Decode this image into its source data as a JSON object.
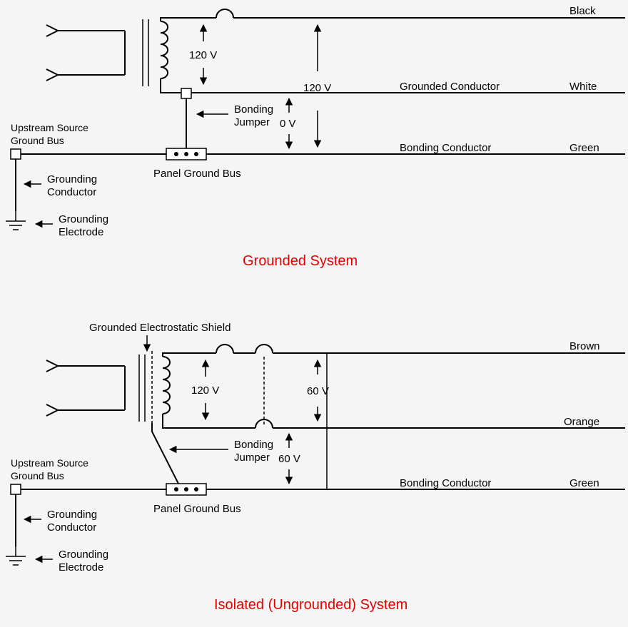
{
  "top": {
    "title": "Grounded System",
    "wire_black": "Black",
    "wire_white": "White",
    "wire_green": "Green",
    "grounded_conductor": "Grounded Conductor",
    "bonding_conductor": "Bonding Conductor",
    "v_xfmr": "120 V",
    "v_total": "120 V",
    "v_lower": "0 V",
    "bonding_jumper": "Bonding",
    "bonding_jumper2": "Jumper",
    "panel_ground_bus": "Panel Ground Bus",
    "upstream1": "Upstream Source",
    "upstream2": "Ground Bus",
    "grounding_conductor": "Grounding",
    "grounding_conductor2": "Conductor",
    "grounding_electrode": "Grounding",
    "grounding_electrode2": "Electrode"
  },
  "bottom": {
    "title": "Isolated (Ungrounded) System",
    "shield_label": "Grounded Electrostatic Shield",
    "wire_brown": "Brown",
    "wire_orange": "Orange",
    "wire_green": "Green",
    "bonding_conductor": "Bonding Conductor",
    "v_xfmr": "120 V",
    "v_upper": "60 V",
    "v_lower": "60 V",
    "bonding_jumper": "Bonding",
    "bonding_jumper2": "Jumper",
    "panel_ground_bus": "Panel Ground Bus",
    "upstream1": "Upstream Source",
    "upstream2": "Ground Bus",
    "grounding_conductor": "Grounding",
    "grounding_conductor2": "Conductor",
    "grounding_electrode": "Grounding",
    "grounding_electrode2": "Electrode"
  }
}
